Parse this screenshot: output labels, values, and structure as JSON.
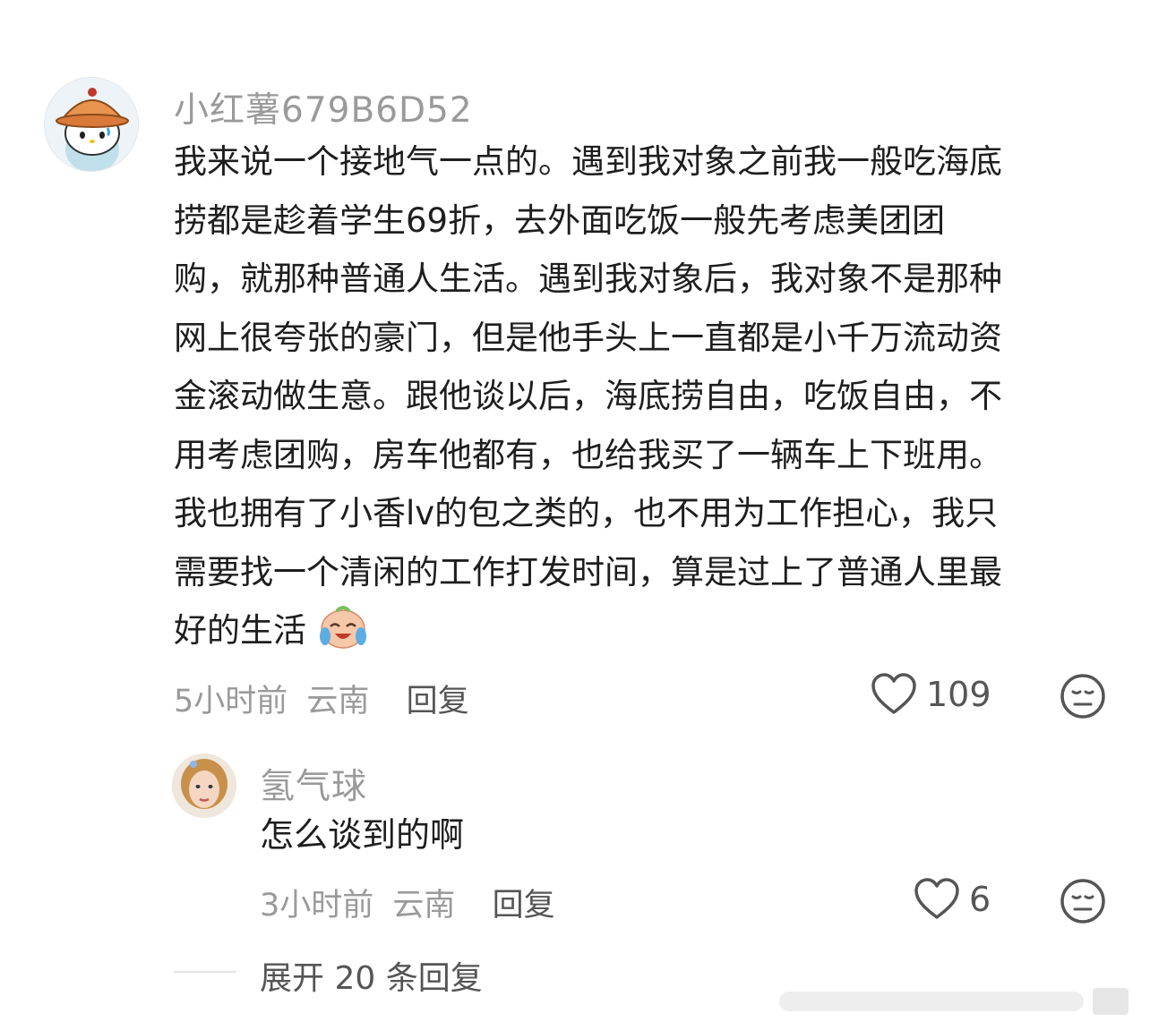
{
  "comment": {
    "username": "小红薯679B6D52",
    "lines": [
      "我来说一个接地气一点的。遇到我对象之前我一般吃海底",
      "捞都是趁着学生69折，去外面吃饭一般先考虑美团团",
      "购，就那种普通人生活。遇到我对象后，我对象不是那种",
      "网上很夸张的豪门，但是他手头上一直都是小千万流动资",
      "金滚动做生意。跟他谈以后，海底捞自由，吃饭自由，不",
      "用考虑团购，房车他都有，也给我买了一辆车上下班用。",
      "我也拥有了小香lv的包之类的，也不用为工作担心，我只",
      "需要找一个清闲的工作打发时间，算是过上了普通人里最",
      "好的生活"
    ],
    "time": "5小时前",
    "location": "云南",
    "reply_label": "回复",
    "likes": "109"
  },
  "reply": {
    "username": "氢气球",
    "text": "怎么谈到的啊",
    "time": "3小时前",
    "location": "云南",
    "reply_label": "回复",
    "likes": "6"
  },
  "expand_label": "展开 20 条回复",
  "icons": {
    "like": "heart-icon",
    "dislike": "neutral-face-icon",
    "emoji": "crying-laughing-emoji"
  }
}
